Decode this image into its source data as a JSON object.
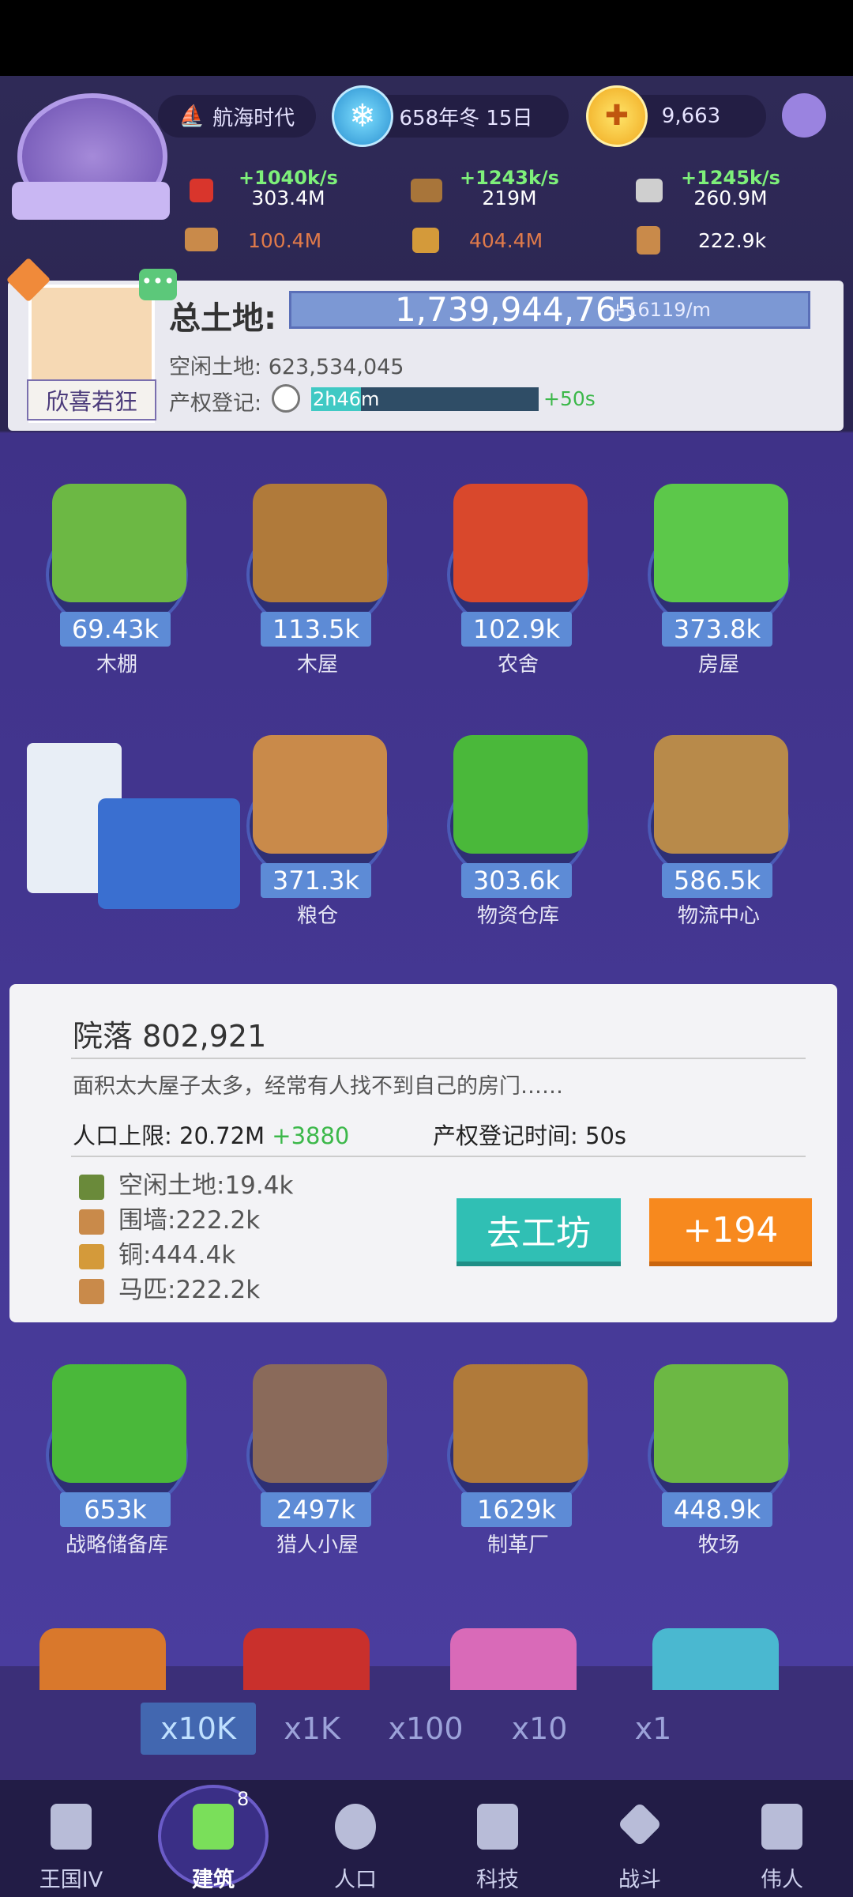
{
  "header": {
    "era": "航海时代",
    "date": "658年冬 15日",
    "gold": "9,663"
  },
  "resources_top": [
    {
      "rate": "+1040k/s",
      "amount": "303.4M",
      "icon": "apple-icon",
      "color": "#d9352c"
    },
    {
      "rate": "+1243k/s",
      "amount": "219M",
      "icon": "wood-icon",
      "color": "#a8753a"
    },
    {
      "rate": "+1245k/s",
      "amount": "260.9M",
      "icon": "stone-icon",
      "color": "#cfcfcf"
    }
  ],
  "resources_bottom": [
    {
      "amount": "100.4M",
      "icon": "fence-icon",
      "color": "#e07a4a"
    },
    {
      "amount": "404.4M",
      "icon": "copper-icon",
      "color": "#e07a4a"
    },
    {
      "amount": "222.9k",
      "icon": "horse-icon",
      "color": "#ffffff"
    }
  ],
  "land": {
    "avatar_name": "欣喜若狂",
    "total_label": "总土地:",
    "total_value": "1,739,944,765",
    "total_rate": "+16119/m",
    "idle_label": "空闲土地:",
    "idle_value": "623,534,045",
    "reg_label": "产权登记:",
    "reg_time": "2h46m",
    "reg_progress": 0.22,
    "reg_plus": "+50s"
  },
  "buildings_row1": [
    {
      "level": "69.43k",
      "name": "木棚",
      "color": "#6cb844"
    },
    {
      "level": "113.5k",
      "name": "木屋",
      "color": "#b07a3a"
    },
    {
      "level": "102.9k",
      "name": "农舍",
      "color": "#d9482c"
    },
    {
      "level": "373.8k",
      "name": "房屋",
      "color": "#5cc84a"
    }
  ],
  "buildings_row2": [
    {
      "level": "371.3k",
      "name": "粮仓",
      "color": "#c98a4a"
    },
    {
      "level": "303.6k",
      "name": "物资仓库",
      "color": "#4ab83a"
    },
    {
      "level": "586.5k",
      "name": "物流中心",
      "color": "#b88a4a"
    }
  ],
  "info": {
    "title": "院落",
    "count": "802,921",
    "desc": "面积太大屋子太多，经常有人找不到自己的房门……",
    "cap_label": "人口上限:",
    "cap_value": "20.72M",
    "cap_plus": "+3880",
    "reg_label": "产权登记时间:",
    "reg_value": "50s",
    "costs": [
      {
        "label": "空闲土地:",
        "value": "19.4k",
        "icon": "grass-icon",
        "color": "#6a8a3a"
      },
      {
        "label": "围墙:",
        "value": "222.2k",
        "icon": "fence-icon",
        "color": "#c98a4a"
      },
      {
        "label": "铜:",
        "value": "444.4k",
        "icon": "copper-icon",
        "color": "#d49a3a"
      },
      {
        "label": "马匹:",
        "value": "222.2k",
        "icon": "horse-icon",
        "color": "#c98a4a"
      }
    ],
    "go_label": "去工坊",
    "plus_label": "+194"
  },
  "buildings_row3": [
    {
      "level": "653k",
      "name": "战略储备库",
      "color": "#4ab83a"
    },
    {
      "level": "2497k",
      "name": "猎人小屋",
      "color": "#8a6a5a"
    },
    {
      "level": "1629k",
      "name": "制革厂",
      "color": "#b07a3a"
    },
    {
      "level": "448.9k",
      "name": "牧场",
      "color": "#6cb844"
    }
  ],
  "multipliers": [
    "x10K",
    "x1K",
    "x100",
    "x10",
    "x1"
  ],
  "nav": [
    {
      "label": "王国IV",
      "icon": "castle-icon"
    },
    {
      "label": "建筑",
      "icon": "house-icon",
      "badge": "8"
    },
    {
      "label": "人口",
      "icon": "person-icon"
    },
    {
      "label": "科技",
      "icon": "book-icon"
    },
    {
      "label": "战斗",
      "icon": "swords-icon"
    },
    {
      "label": "伟人",
      "icon": "statue-icon"
    }
  ]
}
